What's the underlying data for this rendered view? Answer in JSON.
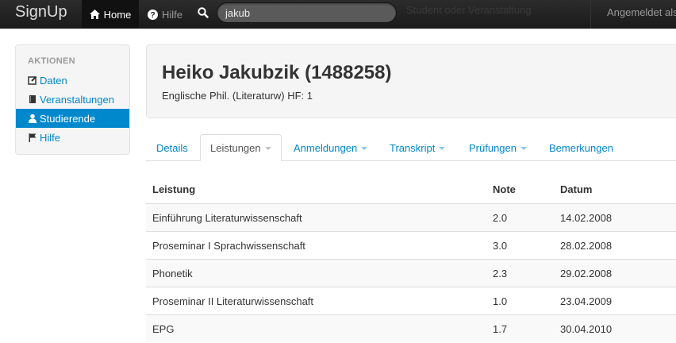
{
  "navbar": {
    "brand": "SignUp",
    "home_label": "Home",
    "hilfe_label": "Hilfe",
    "search_value": "jakub",
    "search_ghost": "Student oder Veranstaltung",
    "user_text": "Angemeldet als"
  },
  "sidebar": {
    "header": "Aktionen",
    "items": [
      {
        "label": "Daten",
        "icon": "edit-icon"
      },
      {
        "label": "Veranstaltungen",
        "icon": "book-icon"
      },
      {
        "label": "Studierende",
        "icon": "user-icon",
        "active": true
      },
      {
        "label": "Hilfe",
        "icon": "flag-icon"
      }
    ]
  },
  "student": {
    "name": "Heiko Jakubzik (1488258)",
    "program": "Englische Phil. (Literaturw) HF: 1"
  },
  "tabs": [
    {
      "label": "Details"
    },
    {
      "label": "Leistungen",
      "active": true
    },
    {
      "label": "Anmeldungen"
    },
    {
      "label": "Transkript"
    },
    {
      "label": "Prüfungen"
    },
    {
      "label": "Bemerkungen"
    }
  ],
  "table": {
    "headers": [
      "Leistung",
      "Note",
      "Datum"
    ],
    "rows": [
      [
        "Einführung Literaturwissenschaft",
        "2.0",
        "14.02.2008"
      ],
      [
        "Proseminar I Sprachwissenschaft",
        "3.0",
        "28.02.2008"
      ],
      [
        "Phonetik",
        "2.3",
        "29.02.2008"
      ],
      [
        "Proseminar II Literaturwissenschaft",
        "1.0",
        "23.04.2009"
      ],
      [
        "EPG",
        "1.7",
        "30.04.2010"
      ]
    ]
  },
  "colors": {
    "accent": "#0088cc",
    "navbar": "#1b1b1b"
  }
}
